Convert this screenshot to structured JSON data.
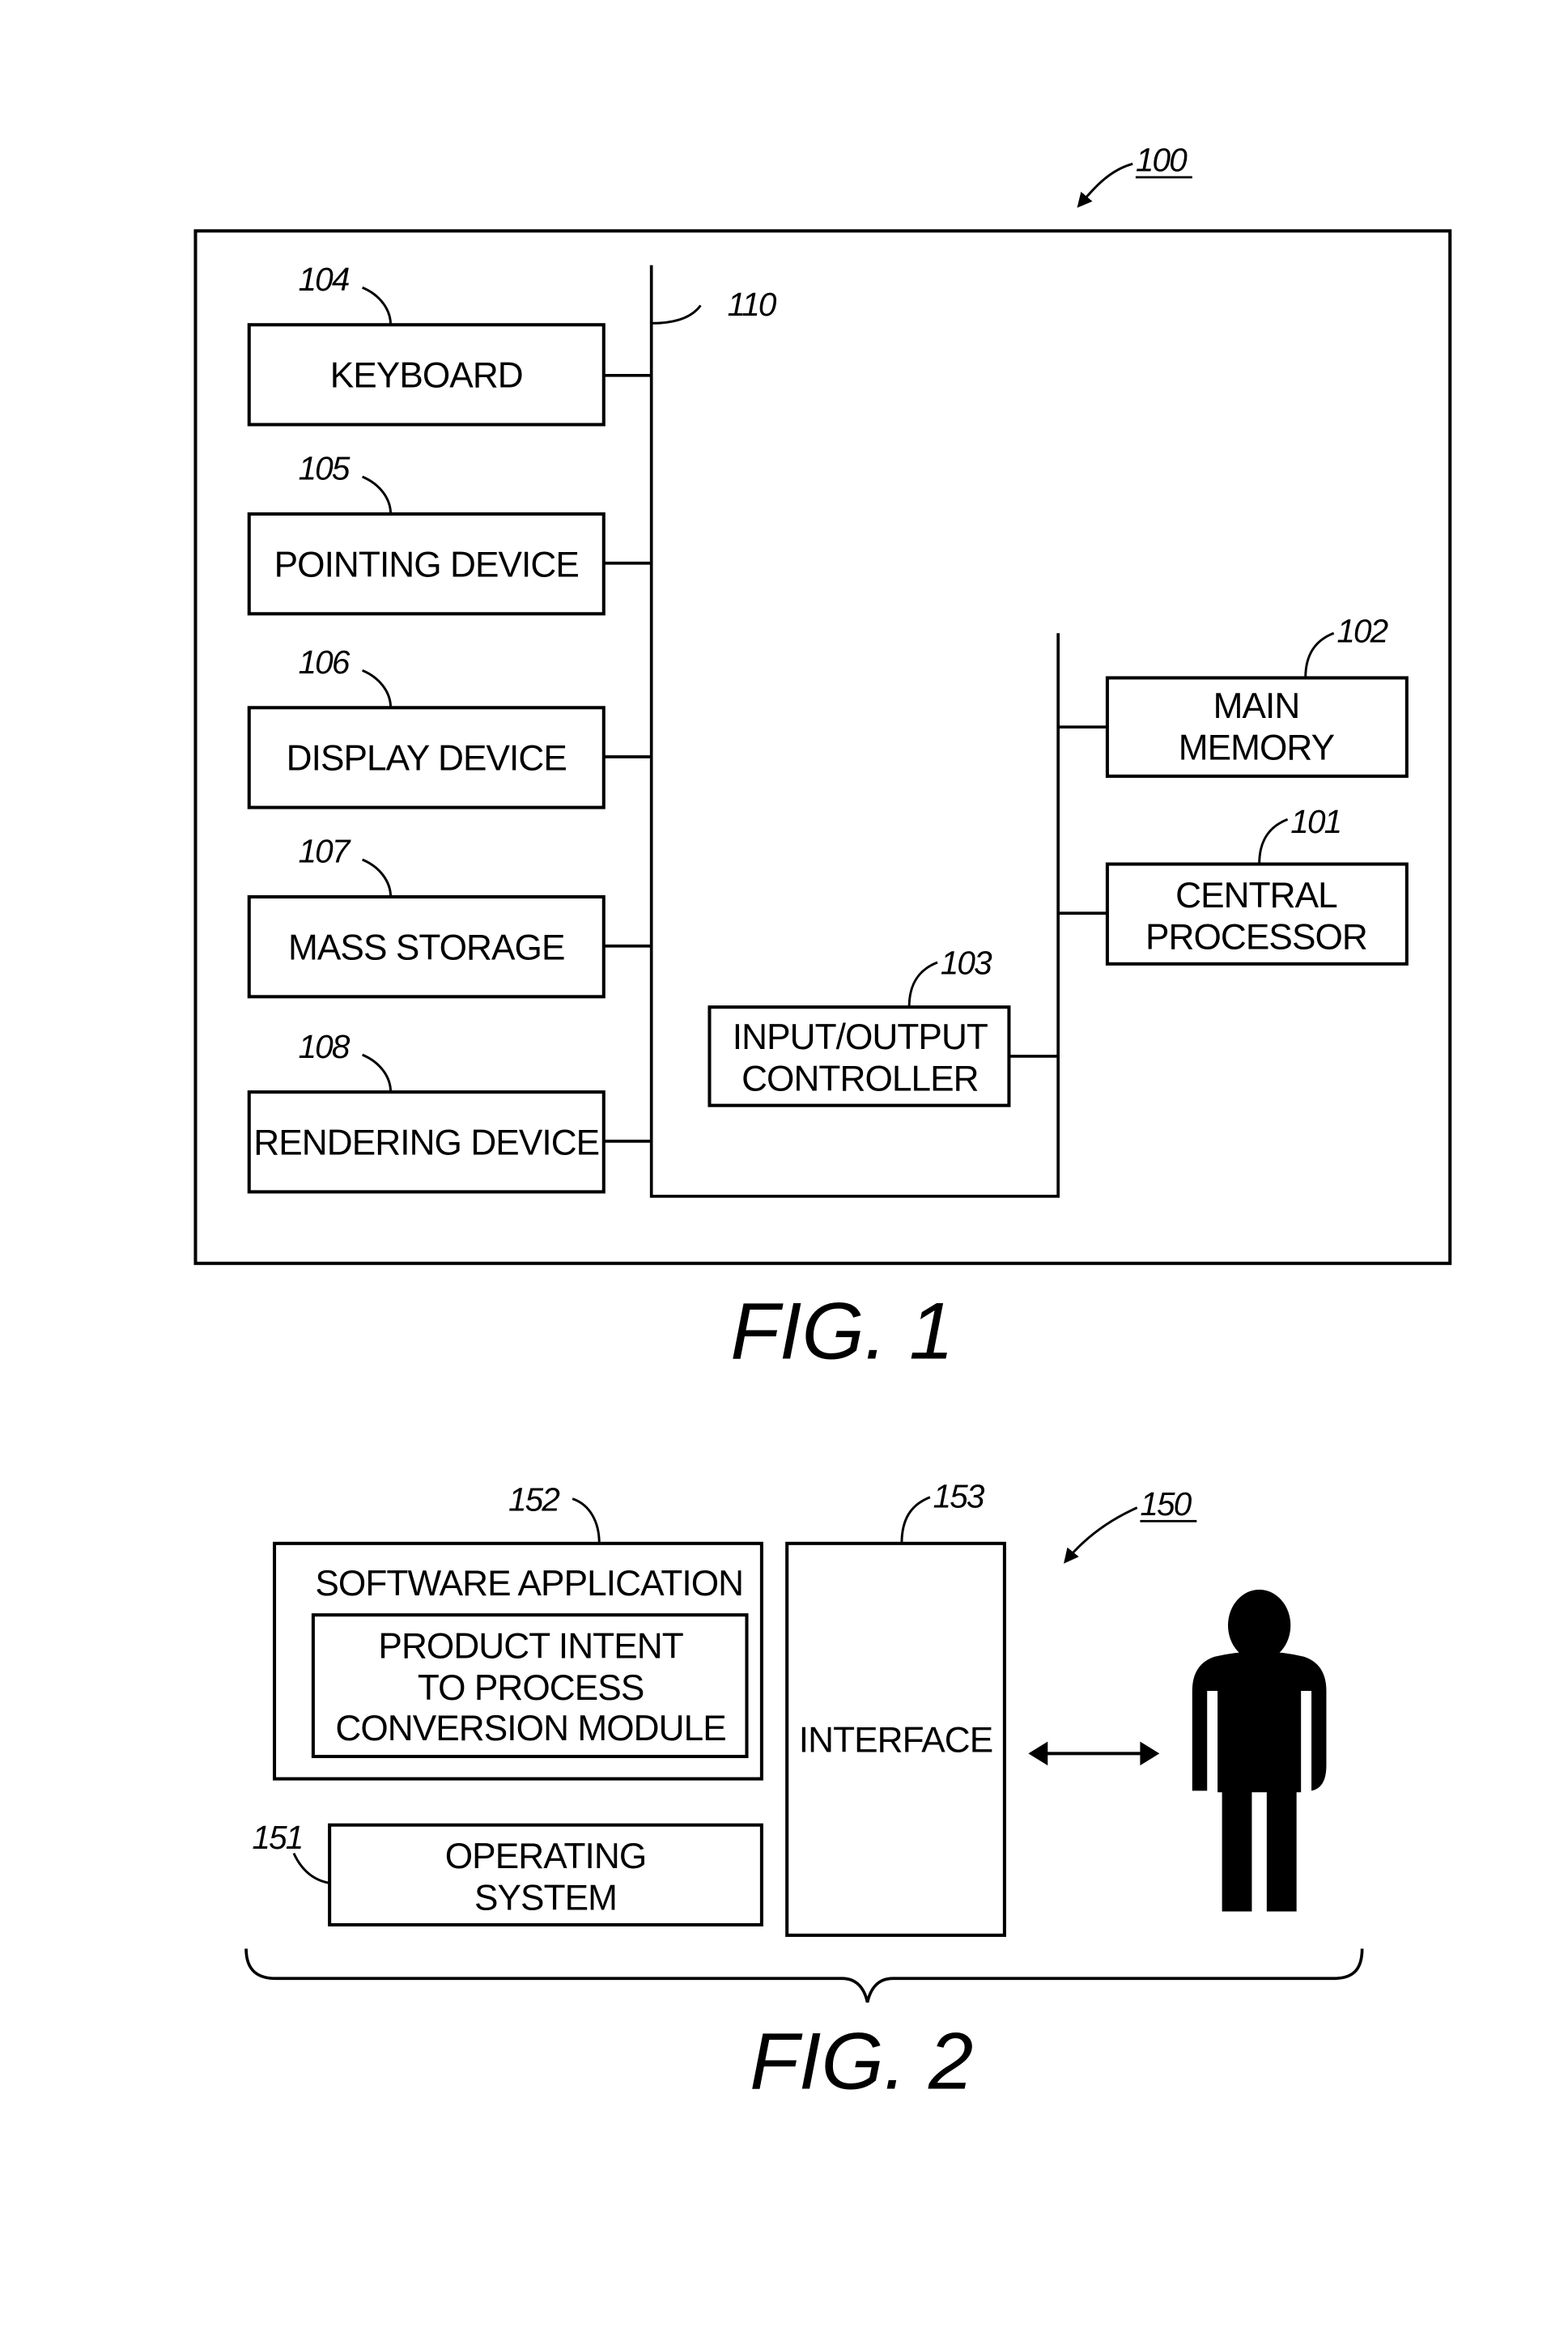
{
  "figure1": {
    "caption": "FIG. 1",
    "ref_system": "100",
    "ref_bus": "110",
    "devices": [
      {
        "ref": "104",
        "label": "KEYBOARD"
      },
      {
        "ref": "105",
        "label": "POINTING DEVICE"
      },
      {
        "ref": "106",
        "label": "DISPLAY DEVICE"
      },
      {
        "ref": "107",
        "label": "MASS STORAGE"
      },
      {
        "ref": "108",
        "label": "RENDERING DEVICE"
      }
    ],
    "main_memory": {
      "ref": "102",
      "line1": "MAIN",
      "line2": "MEMORY"
    },
    "central_processor": {
      "ref": "101",
      "line1": "CENTRAL",
      "line2": "PROCESSOR"
    },
    "io_controller": {
      "ref": "103",
      "line1": "INPUT/OUTPUT",
      "line2": "CONTROLLER"
    }
  },
  "figure2": {
    "caption": "FIG. 2",
    "ref_system": "150",
    "software_application": {
      "ref": "152",
      "label": "SOFTWARE APPLICATION"
    },
    "module": {
      "line1": "PRODUCT INTENT",
      "line2": "TO PROCESS",
      "line3": "CONVERSION MODULE"
    },
    "operating_system": {
      "ref": "151",
      "line1": "OPERATING",
      "line2": "SYSTEM"
    },
    "interface": {
      "ref": "153",
      "label": "INTERFACE"
    }
  }
}
